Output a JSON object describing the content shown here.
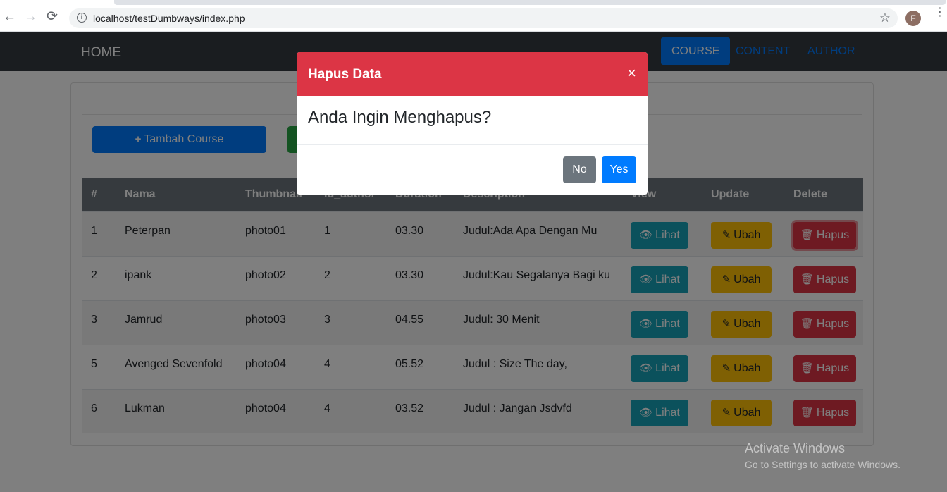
{
  "browser": {
    "url": "localhost/testDumbways/index.php",
    "back_icon": "←",
    "forward_icon": "→",
    "reload_icon": "⟳",
    "info_icon": "i",
    "star_icon": "☆",
    "avatar_initial": "F",
    "menu_icon": "⋮"
  },
  "navbar": {
    "brand": "HOME",
    "links": [
      {
        "label": "COURSE",
        "active": true
      },
      {
        "label": "CONTENT",
        "active": false
      },
      {
        "label": "AUTHOR",
        "active": false
      }
    ]
  },
  "toolbar": {
    "add_label": "Tambah Course",
    "add_icon": "+"
  },
  "table": {
    "headers": [
      "#",
      "Nama",
      "Thumbnail",
      "Id_author",
      "Duration",
      "Description",
      "View",
      "Update",
      "Delete"
    ],
    "rows": [
      {
        "no": "1",
        "nama": "Peterpan",
        "thumbnail": "photo01",
        "id_author": "1",
        "duration": "03.30",
        "description": "Judul:Ada Apa Dengan Mu"
      },
      {
        "no": "2",
        "nama": "ipank",
        "thumbnail": "photo02",
        "id_author": "2",
        "duration": "03.30",
        "description": "Judul:Kau Segalanya Bagi ku"
      },
      {
        "no": "3",
        "nama": "Jamrud",
        "thumbnail": "photo03",
        "id_author": "3",
        "duration": "04.55",
        "description": "Judul: 30 Menit"
      },
      {
        "no": "5",
        "nama": "Avenged Sevenfold",
        "thumbnail": "photo04",
        "id_author": "4",
        "duration": "05.52",
        "description": "Judul : Size The day,"
      },
      {
        "no": "6",
        "nama": "Lukman",
        "thumbnail": "photo04",
        "id_author": "4",
        "duration": "03.52",
        "description": "Judul : Jangan Jsdvfd"
      }
    ],
    "view_label": "Lihat",
    "update_label": "Ubah",
    "delete_label": "Hapus",
    "view_icon": "👁",
    "update_icon": "✎",
    "delete_icon": "🗑"
  },
  "modal": {
    "title": "Hapus Data",
    "close_icon": "×",
    "question": "Anda Ingin Menghapus?",
    "no_label": "No",
    "yes_label": "Yes"
  },
  "watermark": {
    "line1": "Activate Windows",
    "line2": "Go to Settings to activate Windows."
  },
  "colors": {
    "navbar": "#343a40",
    "primary": "#007bff",
    "danger": "#dc3545",
    "warning": "#ffc107",
    "info": "#17a2b8",
    "secondary": "#6c757d"
  }
}
